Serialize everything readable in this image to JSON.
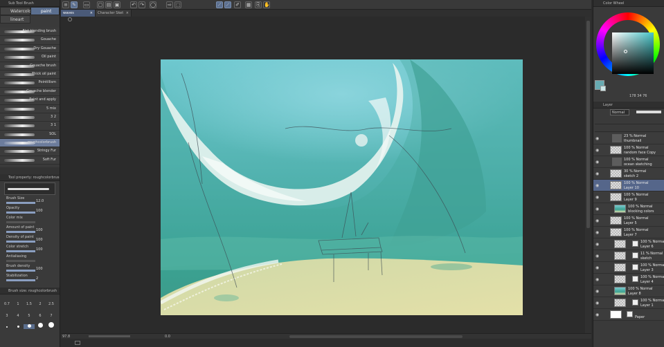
{
  "subtool": {
    "title": "Sub Tool Brush",
    "tabs": [
      "Watercolor",
      "paint",
      "lineart"
    ],
    "brushes": [
      "Flat blending brush",
      "Gouache",
      "Dry Gouache",
      "Oil paint",
      "Gouache brush",
      "Thick oil paint",
      "Pointillism",
      "Gouache blender",
      "Paint and apply",
      "5 mix",
      "3 2",
      "3 1",
      "SOL",
      "roughcolorbrush",
      "Stringy Fur",
      "Soft Fur"
    ],
    "selected_brush": 13
  },
  "tool_property": {
    "title": "Tool property: roughcolorbrush",
    "rows": [
      {
        "label": "Brush Size",
        "value": "12.0"
      },
      {
        "label": "Opacity",
        "value": "100"
      },
      {
        "label": "Color mix",
        "value": ""
      },
      {
        "label": "Amount of paint",
        "value": "100"
      },
      {
        "label": "Density of paint",
        "value": "100"
      },
      {
        "label": "Color stretch",
        "value": "100"
      },
      {
        "label": "Antialiasing",
        "value": ""
      },
      {
        "label": "Brush density",
        "value": "100"
      },
      {
        "label": "Stabilization",
        "value": "2"
      }
    ]
  },
  "brush_size": {
    "title": "Brush size: roughcolorbrush",
    "row1": [
      "0.7",
      "1",
      "1.5",
      "2",
      "2.5"
    ],
    "row2": [
      "3",
      "4",
      "5",
      "6",
      "7"
    ]
  },
  "doc_tabs": [
    {
      "label": "waves",
      "selected": true
    },
    {
      "label": "Character Sket",
      "selected": false
    }
  ],
  "status": {
    "zoom": "97.8",
    "angle": "0.0"
  },
  "color_wheel": {
    "title": "Color Wheel",
    "h": "178",
    "s": "34",
    "v": "76",
    "hue_color": "#46c4c8"
  },
  "layer_panel": {
    "title": "Layer",
    "blend_mode": "Normal",
    "opacity": "100",
    "layers": [
      {
        "line1": "23 % Normal",
        "line2": "thumbnail",
        "kind": "folder"
      },
      {
        "line1": "100 % Normal",
        "line2": "random face Copy",
        "kind": "chk"
      },
      {
        "line1": "100 % Normal",
        "line2": "ocean sketching",
        "kind": "folder"
      },
      {
        "line1": "30 % Normal",
        "line2": "sketch 2",
        "kind": "chk"
      },
      {
        "line1": "100 % Normal",
        "line2": "Layer 10",
        "kind": "chk",
        "selected": true
      },
      {
        "line1": "100 % Normal",
        "line2": "Layer 9",
        "kind": "chk"
      },
      {
        "line1": "100 % Normal",
        "line2": "blocking colors",
        "kind": "teal"
      },
      {
        "line1": "100 % Normal",
        "line2": "Layer 5",
        "kind": "chk"
      },
      {
        "line1": "100 % Normal",
        "line2": "Layer 7",
        "kind": "chk"
      },
      {
        "line1": "100 % Normal",
        "line2": "Layer 6",
        "kind": "mask"
      },
      {
        "line1": "11 % Normal",
        "line2": "sketch",
        "kind": "mask"
      },
      {
        "line1": "100 % Normal",
        "line2": "Layer 3",
        "kind": "mask"
      },
      {
        "line1": "100 % Normal",
        "line2": "Layer 4",
        "kind": "mask"
      },
      {
        "line1": "100 % Normal",
        "line2": "Layer 8",
        "kind": "teal"
      },
      {
        "line1": "100 % Normal",
        "line2": "Layer 1",
        "kind": "mask"
      },
      {
        "line1": "",
        "line2": "Paper",
        "kind": "paper"
      }
    ]
  }
}
